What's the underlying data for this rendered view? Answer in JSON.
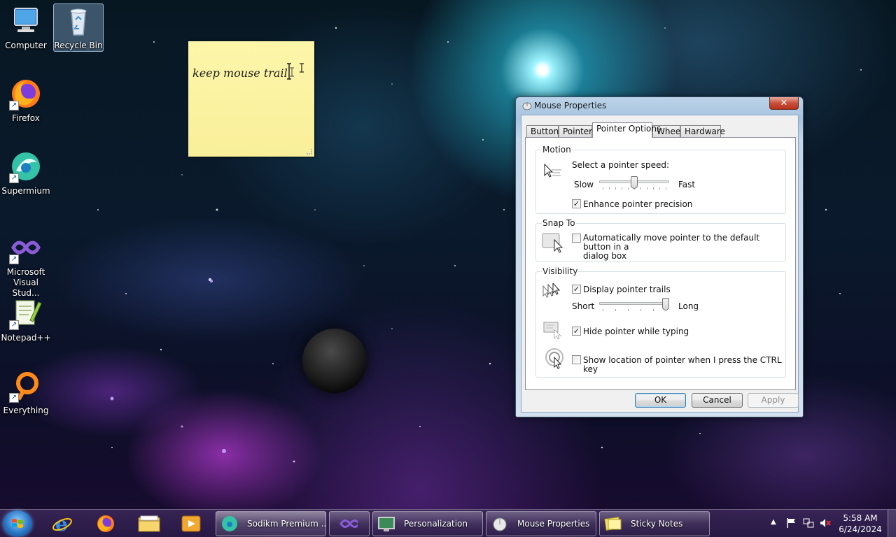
{
  "desktop": {
    "icons": [
      {
        "label": "Computer",
        "icon": "computer-icon"
      },
      {
        "label": "Recycle Bin",
        "icon": "recycle-bin-icon"
      },
      {
        "label": "Firefox",
        "icon": "firefox-icon"
      },
      {
        "label": "Supermium",
        "icon": "supermium-icon"
      },
      {
        "label": "Microsoft Visual Stud...",
        "icon": "visual-studio-icon"
      },
      {
        "label": "Notepad++",
        "icon": "notepadpp-icon"
      },
      {
        "label": "Everything",
        "icon": "everything-icon"
      }
    ]
  },
  "sticky_note": {
    "text": "keep mouse trail",
    "color": "#fdf6a9"
  },
  "dialog": {
    "title": "Mouse Properties",
    "close_symbol": "✕",
    "tabs": [
      "Buttons",
      "Pointers",
      "Pointer Options",
      "Wheel",
      "Hardware"
    ],
    "active_tab": "Pointer Options",
    "motion": {
      "group_label": "Motion",
      "speed_label": "Select a pointer speed:",
      "slow_label": "Slow",
      "fast_label": "Fast",
      "speed_value": 0.5,
      "enhance_label": "Enhance pointer precision",
      "enhance_checked": true
    },
    "snap_to": {
      "group_label": "Snap To",
      "auto_move_label_line1": "Automatically move pointer to the default button in a",
      "auto_move_label_line2": "dialog box",
      "auto_move_checked": false
    },
    "visibility": {
      "group_label": "Visibility",
      "trails_label": "Display pointer trails",
      "trails_checked": true,
      "short_label": "Short",
      "long_label": "Long",
      "trail_length_value": 1.0,
      "hide_label": "Hide pointer while typing",
      "hide_checked": true,
      "ctrl_label": "Show location of pointer when I press the CTRL key",
      "ctrl_checked": false
    },
    "buttons": {
      "ok": "OK",
      "cancel": "Cancel",
      "apply": "Apply"
    }
  },
  "taskbar": {
    "pinned": [
      "internet-explorer-icon",
      "firefox-icon",
      "file-explorer-icon",
      "media-player-icon"
    ],
    "tasks": [
      {
        "label": "Sodikm Premium ...",
        "icon": "supermium-icon"
      },
      {
        "label": "",
        "icon": "visual-studio-icon"
      },
      {
        "label": "Personalization",
        "icon": "personalization-icon"
      },
      {
        "label": "Mouse Properties",
        "icon": "mouse-icon"
      },
      {
        "label": "Sticky Notes",
        "icon": "sticky-notes-icon"
      }
    ],
    "clock_time": "5:58 AM",
    "clock_date": "6/24/2024"
  }
}
